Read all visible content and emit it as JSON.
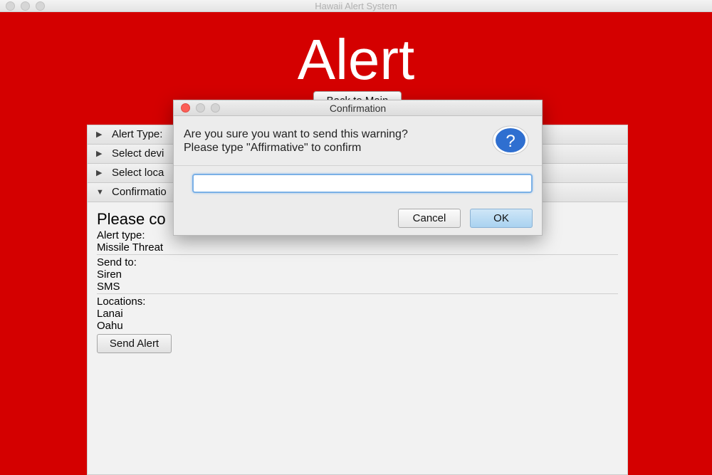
{
  "window": {
    "title": "Hawaii Alert System"
  },
  "main": {
    "heading": "Alert",
    "back_button": "Back to Main"
  },
  "accordion": {
    "sections": [
      {
        "label": "Alert Type:",
        "expanded": false
      },
      {
        "label": "Select devi",
        "expanded": false
      },
      {
        "label": "Select loca",
        "expanded": false
      },
      {
        "label": "Confirmatio",
        "expanded": true
      }
    ],
    "confirmation": {
      "heading": "Please co",
      "alert_type_label": "Alert type:",
      "alert_type_value": "Missile Threat",
      "send_to_label": "Send to:",
      "send_to_values": [
        "Siren",
        "SMS"
      ],
      "locations_label": "Locations:",
      "locations_values": [
        "Lanai",
        "Oahu"
      ],
      "send_button": "Send Alert"
    }
  },
  "dialog": {
    "title": "Confirmation",
    "message_line1": "Are you sure you want to send this warning?",
    "message_line2": "Please type \"Affirmative\" to confirm",
    "icon": "question-icon",
    "input_value": "",
    "cancel_label": "Cancel",
    "ok_label": "OK"
  },
  "colors": {
    "background": "#d40000",
    "dialog_ok": "#a9d2f0",
    "question_icon": "#2f6fd0"
  }
}
